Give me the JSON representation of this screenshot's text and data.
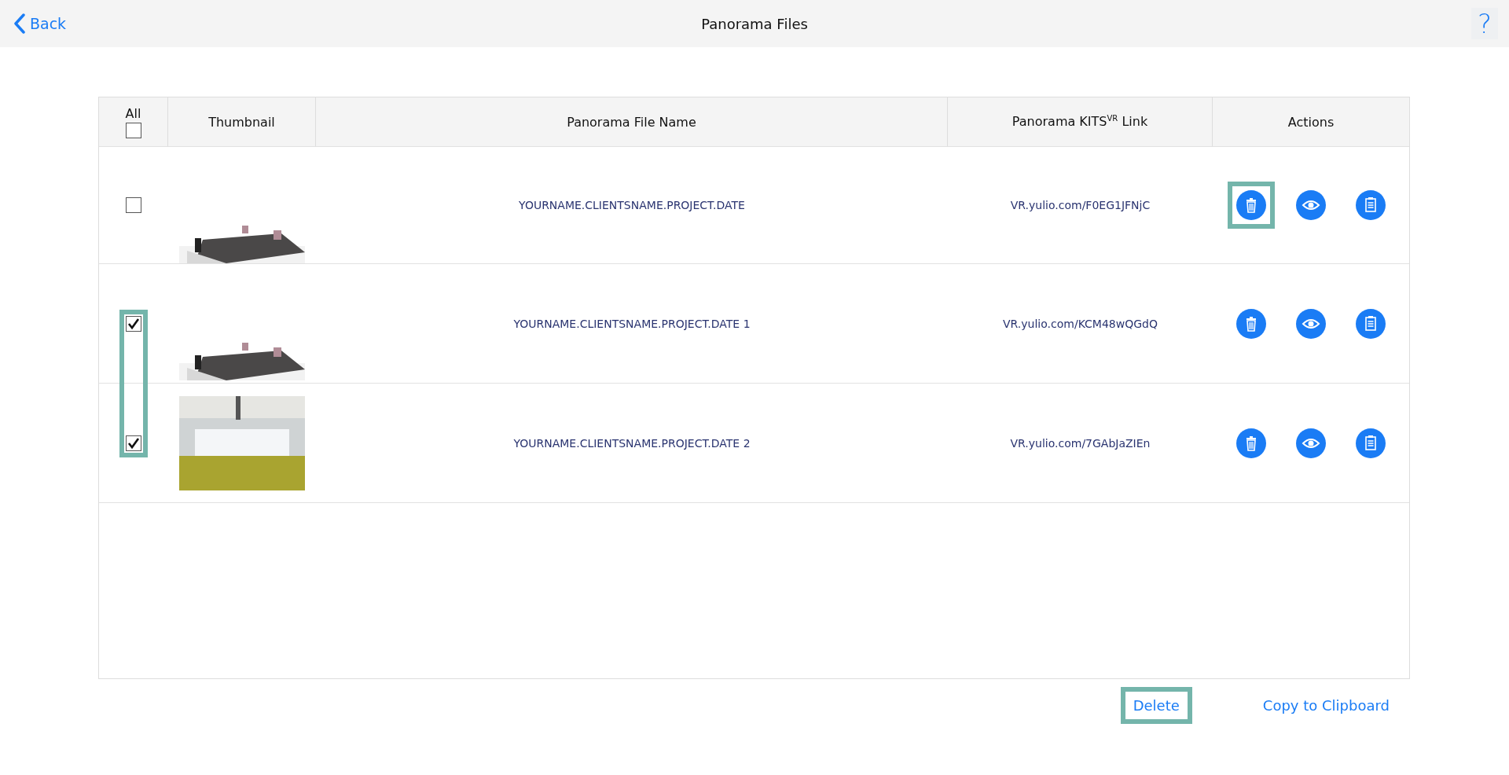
{
  "header": {
    "back": "Back",
    "title": "Panorama Files",
    "help": "?"
  },
  "table": {
    "select_all": {
      "label": "All",
      "checked": false
    },
    "columns": [
      "Thumbnail",
      "Panorama File Name",
      "Panorama KITS$^{VR}$ Link",
      "Actions"
    ],
    "rows": [
      {
        "checked": false,
        "checkbox_highlighted": false,
        "thumbnail": {
          "kind": "furniture"
        },
        "name": "YOURNAME.CLIENTSNAME.PROJECT.DATE",
        "link": "VR.yulio.com/F0EG1JFNjC",
        "delete_highlighted": true
      },
      {
        "checked": true,
        "checkbox_highlighted": true,
        "thumbnail": {
          "kind": "furniture"
        },
        "name": "YOURNAME.CLIENTSNAME.PROJECT.DATE 1",
        "link": "VR.yulio.com/KCM48wQGdQ",
        "delete_highlighted": false
      },
      {
        "checked": true,
        "checkbox_highlighted": true,
        "thumbnail": {
          "kind": "room"
        },
        "name": "YOURNAME.CLIENTSNAME.PROJECT.DATE 2",
        "link": "VR.yulio.com/7GAbJaZIEn",
        "delete_highlighted": false
      }
    ]
  },
  "footer": {
    "buttons": [
      {
        "label": "Delete",
        "highlighted": true
      },
      {
        "label": "Copy to Clipboard",
        "highlighted": false
      }
    ]
  }
}
